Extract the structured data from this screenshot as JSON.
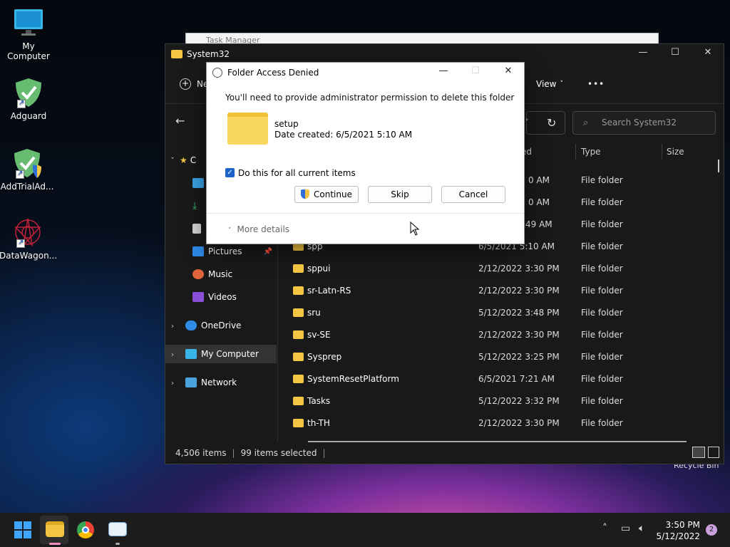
{
  "desktop": {
    "icons": [
      {
        "label": "My Computer",
        "icon": "monitor-icon"
      },
      {
        "label": "Adguard",
        "icon": "adguard-shield-icon"
      },
      {
        "label": "AddTrialAd...",
        "icon": "adguard-shield-uac-icon"
      },
      {
        "label": "DataWagon...",
        "icon": "datawagon-star-icon"
      }
    ],
    "recycle_label": "Recycle Bin"
  },
  "task_manager_title": "Task Manager",
  "explorer": {
    "title": "System32",
    "new_label": "Ne",
    "view_label": "View",
    "more_glyph": "•••",
    "search_placeholder": "Search System32",
    "columns": {
      "date": "ed",
      "type": "Type",
      "size": "Size"
    },
    "sidebar": {
      "pictures": "Pictures",
      "music": "Music",
      "videos": "Videos",
      "onedrive": "OneDrive",
      "my_computer": "My Computer",
      "network": "Network",
      "quick_access_stub": "C"
    },
    "partial_rows": [
      {
        "date": "0 AM",
        "type": "File folder"
      },
      {
        "date": "0 AM",
        "type": "File folder"
      },
      {
        "date": "49 AM",
        "type": "File folder"
      }
    ],
    "rows": [
      {
        "name": "spp",
        "date": "6/5/2021 5:10 AM",
        "type": "File folder"
      },
      {
        "name": "sppui",
        "date": "2/12/2022 3:30 PM",
        "type": "File folder"
      },
      {
        "name": "sr-Latn-RS",
        "date": "2/12/2022 3:30 PM",
        "type": "File folder"
      },
      {
        "name": "sru",
        "date": "5/12/2022 3:48 PM",
        "type": "File folder"
      },
      {
        "name": "sv-SE",
        "date": "2/12/2022 3:30 PM",
        "type": "File folder"
      },
      {
        "name": "Sysprep",
        "date": "5/12/2022 3:25 PM",
        "type": "File folder"
      },
      {
        "name": "SystemResetPlatform",
        "date": "6/5/2021 7:21 AM",
        "type": "File folder"
      },
      {
        "name": "Tasks",
        "date": "5/12/2022 3:32 PM",
        "type": "File folder"
      },
      {
        "name": "th-TH",
        "date": "2/12/2022 3:30 PM",
        "type": "File folder"
      }
    ],
    "status": {
      "items": "4,506 items",
      "selected": "99 items selected"
    }
  },
  "dialog": {
    "title": "Folder Access Denied",
    "message": "You'll need to provide administrator permission to delete this folder",
    "folder_name": "setup",
    "folder_date": "Date created: 6/5/2021 5:10 AM",
    "checkbox_label": "Do this for all current items",
    "checkbox_checked": true,
    "continue_label": "Continue",
    "skip_label": "Skip",
    "cancel_label": "Cancel",
    "more_details": "More details"
  },
  "taskbar": {
    "time": "3:50 PM",
    "date": "5/12/2022",
    "notification_count": "2",
    "apps": [
      "start-icon",
      "file-explorer-icon",
      "chrome-icon",
      "task-manager-icon"
    ]
  },
  "colors": {
    "accent": "#1c63c7",
    "folder": "#f4c542",
    "explorer_bg": "#191919"
  }
}
